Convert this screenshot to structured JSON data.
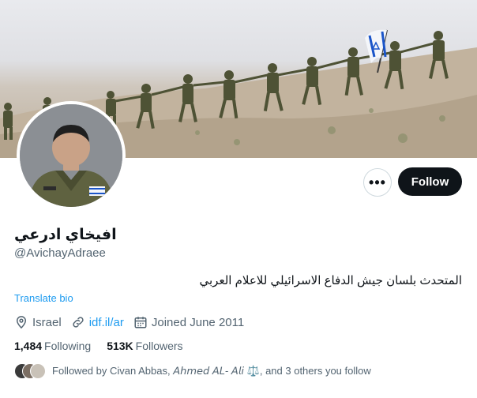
{
  "profile": {
    "display_name": "افيخاي ادرعي",
    "handle": "@AvichayAdraee",
    "bio": "المتحدث بلسان جيش الدفاع الاسرائيلي للاعلام العربي",
    "translate_label": "Translate bio",
    "location": "Israel",
    "website": "idf.il/ar",
    "joined": "Joined June 2011"
  },
  "actions": {
    "more_label": "•••",
    "follow_label": "Follow"
  },
  "stats": {
    "following_count": "1,484",
    "following_label": "Following",
    "followers_count": "513K",
    "followers_label": "Followers"
  },
  "followed_by": {
    "text": "Followed by Civan Abbas, 𝘈𝘩𝘮𝘦𝘥 𝘈𝘓- 𝘈𝘭𝘪 ⚖️, and 3 others you follow"
  },
  "icons": {
    "location": "location-pin-icon",
    "website": "link-icon",
    "joined": "calendar-icon"
  },
  "colors": {
    "accent": "#1d9bf0",
    "text_primary": "#0f1419",
    "text_secondary": "#536471",
    "follow_button": "#0f1419"
  }
}
